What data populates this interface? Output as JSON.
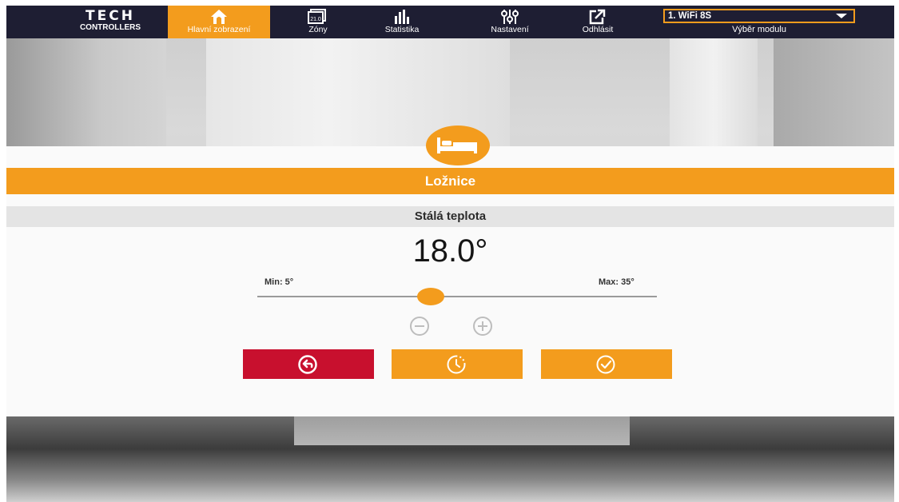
{
  "brand": {
    "line1": "TECH",
    "line2": "CONTROLLERS"
  },
  "nav": {
    "items": [
      {
        "label": "Hlavní zobrazení",
        "icon": "home-icon",
        "active": true
      },
      {
        "label": "Zóny",
        "icon": "zones-icon",
        "active": false,
        "icon_text": "21.0"
      },
      {
        "label": "Statistika",
        "icon": "statistics-icon",
        "active": false
      },
      {
        "label": "Nastavení",
        "icon": "settings-sliders-icon",
        "active": false
      },
      {
        "label": "Odhlásit",
        "icon": "logout-icon",
        "active": false
      }
    ]
  },
  "module": {
    "selected": "1. WiFi 8S",
    "label": "Výběr modulu"
  },
  "zone": {
    "icon": "bed-icon",
    "name": "Ložnice",
    "mode": "Stálá teplota",
    "temperature": "18.0°",
    "min_label": "Min: 5°",
    "max_label": "Max: 35°",
    "min": 5,
    "max": 35,
    "value": 18
  },
  "actions": {
    "back_icon": "back-arrow-icon",
    "timer_icon": "clock-timer-icon",
    "confirm_icon": "check-circle-icon"
  },
  "colors": {
    "accent": "#f39c1d",
    "topbar": "#1e1e33",
    "danger": "#c8102e"
  }
}
